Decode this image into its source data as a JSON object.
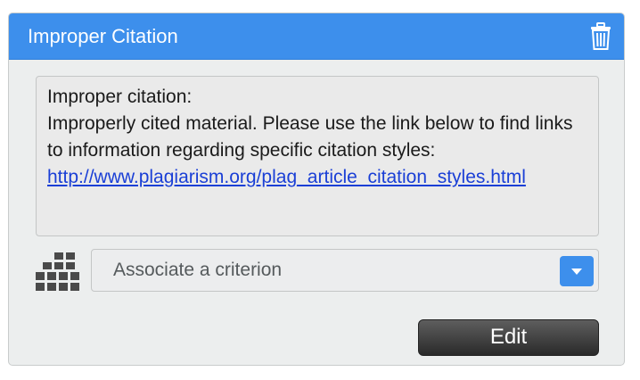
{
  "card": {
    "title": "Improper Citation",
    "delete_icon": "trash-icon"
  },
  "comment": {
    "heading": "Improper citation:",
    "body": "Improperly cited material. Please use the link below to find links to information regarding specific citation styles:",
    "link": "http://www.plagiarism.org/plag_article_citation_styles.html"
  },
  "criterion": {
    "icon": "grid-icon",
    "placeholder": "Associate a criterion",
    "arrow_icon": "chevron-down-icon"
  },
  "actions": {
    "edit_label": "Edit"
  },
  "colors": {
    "header": "#3d8fec",
    "card_bg": "#eceeee",
    "button": "#3a3a3a",
    "link": "#1a3fd6"
  }
}
